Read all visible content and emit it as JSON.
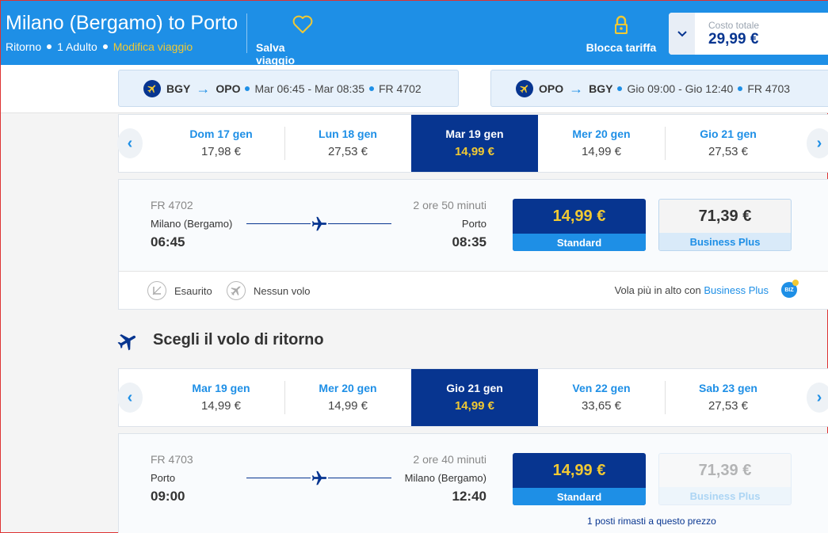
{
  "header": {
    "title": "Milano (Bergamo) to Porto",
    "trip_type": "Ritorno",
    "passengers": "1 Adulto",
    "modify": "Modifica viaggio",
    "save_trip": "Salva viaggio",
    "lock_fare": "Blocca tariffa",
    "total_label": "Costo totale",
    "total_value": "29,99 €"
  },
  "segments": [
    {
      "from": "BGY",
      "to": "OPO",
      "times": "Mar 06:45 - Mar 08:35",
      "flight": "FR 4702"
    },
    {
      "from": "OPO",
      "to": "BGY",
      "times": "Gio 09:00 - Gio 12:40",
      "flight": "FR 4703"
    }
  ],
  "outbound": {
    "dates": [
      {
        "day": "Dom 17 gen",
        "price": "17,98 €"
      },
      {
        "day": "Lun 18 gen",
        "price": "27,53 €"
      },
      {
        "day": "Mar 19 gen",
        "price": "14,99 €",
        "selected": true
      },
      {
        "day": "Mer 20 gen",
        "price": "14,99 €"
      },
      {
        "day": "Gio 21 gen",
        "price": "27,53 €"
      }
    ],
    "flight": {
      "number": "FR 4702",
      "origin": "Milano (Bergamo)",
      "depart": "06:45",
      "duration": "2 ore 50 minuti",
      "destination": "Porto",
      "arrive": "08:35",
      "standard_price": "14,99 €",
      "standard_label": "Standard",
      "business_price": "71,39 €",
      "business_label": "Business Plus"
    },
    "legend": {
      "sold_out": "Esaurito",
      "no_flight": "Nessun volo",
      "upsell_text": "Vola più in alto con",
      "upsell_link": "Business Plus",
      "badge": "BIZ"
    }
  },
  "return_section": {
    "title": "Scegli il volo di ritorno"
  },
  "inbound": {
    "dates": [
      {
        "day": "Mar 19 gen",
        "price": "14,99 €"
      },
      {
        "day": "Mer 20 gen",
        "price": "14,99 €"
      },
      {
        "day": "Gio 21 gen",
        "price": "14,99 €",
        "selected": true
      },
      {
        "day": "Ven 22 gen",
        "price": "33,65 €"
      },
      {
        "day": "Sab 23 gen",
        "price": "27,53 €"
      }
    ],
    "flight": {
      "number": "FR 4703",
      "origin": "Porto",
      "depart": "09:00",
      "duration": "2 ore 40 minuti",
      "destination": "Milano (Bergamo)",
      "arrive": "12:40",
      "standard_price": "14,99 €",
      "standard_label": "Standard",
      "business_price": "71,39 €",
      "business_label": "Business Plus",
      "seats_left": "1 posti rimasti a questo prezzo"
    }
  },
  "colors": {
    "brand_blue": "#1e8fe6",
    "dark_blue": "#073590",
    "yellow": "#f1c933"
  }
}
